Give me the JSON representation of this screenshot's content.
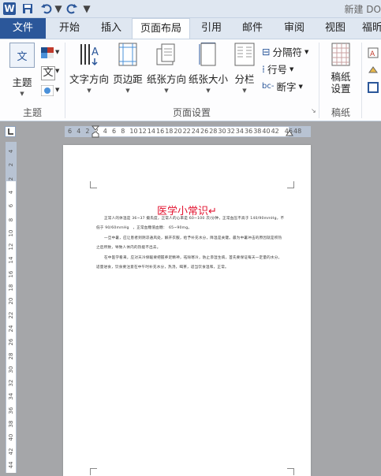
{
  "titlebar": {
    "app_icon": "W",
    "title": "新建 DO"
  },
  "tabs": {
    "file": "文件",
    "home": "开始",
    "insert": "插入",
    "page_layout": "页面布局",
    "references": "引用",
    "mailings": "邮件",
    "review": "审阅",
    "view": "视图",
    "more": "福昕"
  },
  "ribbon": {
    "themes_label": "主题",
    "themes_group": "主题",
    "text_direction": "文字方向",
    "margins": "页边距",
    "orientation": "纸张方向",
    "size": "纸张大小",
    "columns": "分栏",
    "breaks": "分隔符",
    "line_numbers": "行号",
    "hyphenation": "断字",
    "page_setup_group": "页面设置",
    "manuscript_setup": "稿纸\n设置",
    "manuscript_group": "稿纸",
    "theme_icon_text": "文",
    "wen_char": "文"
  },
  "ruler": {
    "h_labels": [
      "6",
      "4",
      "2",
      "2",
      "4",
      "6",
      "8",
      "10",
      "12",
      "14",
      "16",
      "18",
      "20",
      "22",
      "24",
      "26",
      "28",
      "30",
      "32",
      "34",
      "36",
      "38",
      "40",
      "42",
      "46",
      "48"
    ],
    "v_labels": [
      "4",
      "2",
      "2",
      "4",
      "6",
      "8",
      "10",
      "12",
      "14",
      "16",
      "18",
      "20",
      "22",
      "24",
      "26",
      "28",
      "30",
      "32",
      "34",
      "36",
      "38",
      "40",
      "42",
      "44"
    ]
  },
  "document": {
    "title": "医学小常识↵",
    "paragraphs": [
      "正常人的体温是 36~37 摄氏度，正常人的心率是 60~100 次/分钟，正常血压不高于 140/90mmHg，不低于 90/60mmHg　，正常血糖值血糖：　65~90mg。",
      "一旦中暑，应让患者到阴凉通风处，解开衣服，给予补充水分，降温是关键。最为中暑冲击的原因就是积热之后所致，导致人体内的热能不出去。",
      "在中医学看来，应对天冷保暖要把握养足精神，祛除寒冷，防止渗湿生病，首先要保证每天一定量的水分，适量进食，饮食要注意在中午时补充水分，热汤，喝茶，适当饮食温和，正常。"
    ]
  },
  "colors": {
    "accent": "#2b579a",
    "title_red": "#e2122f",
    "workspace": "#a5a6a9"
  }
}
